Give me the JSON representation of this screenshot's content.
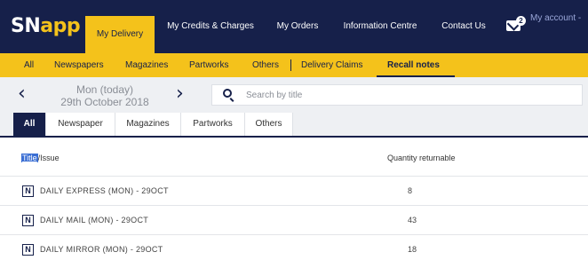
{
  "header": {
    "logo_sn": "SN",
    "logo_app": "app",
    "nav": [
      {
        "label": "My Delivery",
        "active": true
      },
      {
        "label": "My Credits & Charges"
      },
      {
        "label": "My Orders"
      },
      {
        "label": "Information Centre"
      },
      {
        "label": "Contact Us"
      }
    ],
    "notification_count": "2",
    "account_label": "My account -"
  },
  "subnav": {
    "items": [
      {
        "label": "All"
      },
      {
        "label": "Newspapers"
      },
      {
        "label": "Magazines"
      },
      {
        "label": "Partworks"
      },
      {
        "label": "Others"
      },
      {
        "label": "Delivery Claims"
      },
      {
        "label": "Recall notes",
        "active": true
      }
    ]
  },
  "date_bar": {
    "prev_icon": "chevron-left-icon",
    "next_icon": "chevron-right-icon",
    "day": "Mon (today)",
    "date": "29th October 2018"
  },
  "search": {
    "icon": "search-icon",
    "placeholder": "Search by title"
  },
  "category_tabs": [
    {
      "label": "All",
      "active": true
    },
    {
      "label": "Newspaper"
    },
    {
      "label": "Magazines"
    },
    {
      "label": "Partworks"
    },
    {
      "label": "Others"
    }
  ],
  "table": {
    "headers": {
      "title_highlight": "Title",
      "title_rest": "/Issue",
      "quantity": "Quantity returnable"
    },
    "rows": [
      {
        "icon": "N",
        "title": "DAILY EXPRESS (MON) - 29OCT",
        "qty": "8"
      },
      {
        "icon": "N",
        "title": "DAILY MAIL (MON) - 29OCT",
        "qty": "43"
      },
      {
        "icon": "N",
        "title": "DAILY MIRROR (MON) - 29OCT",
        "qty": "18"
      }
    ]
  },
  "colors": {
    "navy": "#16204a",
    "yellow": "#f4c21b",
    "light_gray": "#eef0f3"
  }
}
